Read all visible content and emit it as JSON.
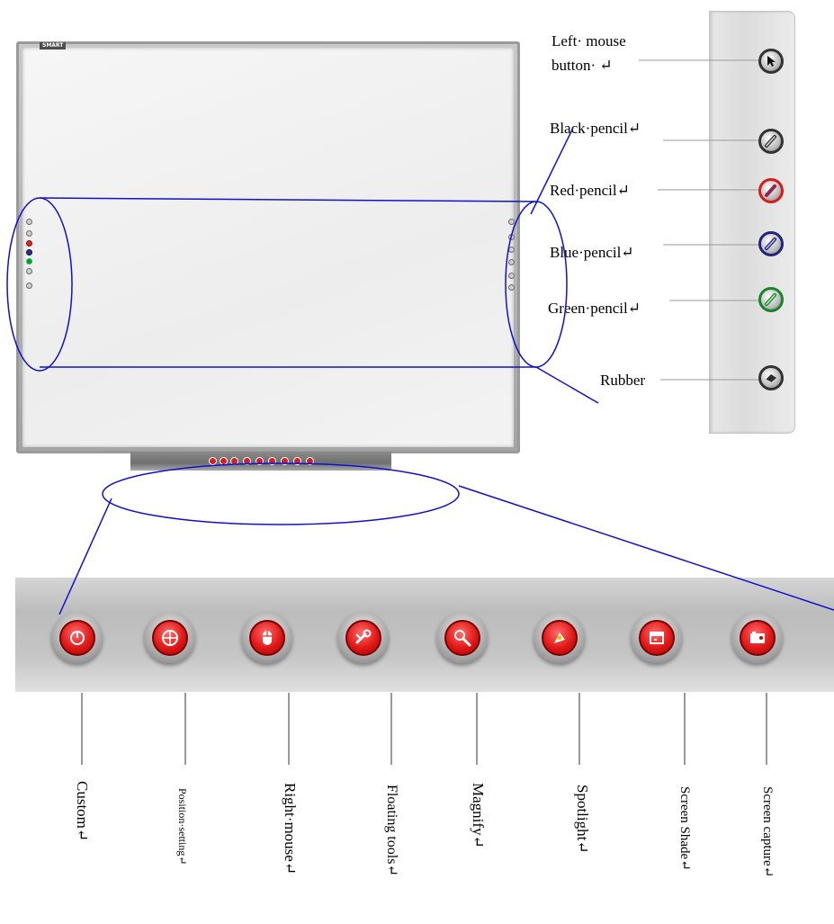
{
  "board": {
    "logo_text": "SMART"
  },
  "side_panel": {
    "items": [
      {
        "label_line1": "Left·     mouse",
        "label_line2": "button· ↵",
        "icon": "cursor-arrow-icon",
        "ring": "#2b2b2b"
      },
      {
        "label": "Black·pencil↵",
        "icon": "pencil-icon",
        "ring": "#2b2b2b"
      },
      {
        "label": "Red·pencil↵",
        "icon": "pencil-icon",
        "ring": "#d41c1c"
      },
      {
        "label": "Blue·pencil↵",
        "icon": "pencil-icon",
        "ring": "#23237a"
      },
      {
        "label": "Green·pencil↵",
        "icon": "pencil-icon",
        "ring": "#17852a"
      },
      {
        "label": "Rubber",
        "icon": "eraser-icon",
        "ring": "#2b2b2b"
      }
    ]
  },
  "toolbar": {
    "items": [
      {
        "label": "Custom↵",
        "icon": "custom-icon"
      },
      {
        "label": "Position·setting↵",
        "icon": "crosshair-icon"
      },
      {
        "label": "Right·mouse↵",
        "icon": "mouse-icon"
      },
      {
        "label": "Floating tools↵",
        "icon": "wrench-icon"
      },
      {
        "label": "Magnify↵",
        "icon": "magnifier-icon"
      },
      {
        "label": "Spotlight↵",
        "icon": "spotlight-icon"
      },
      {
        "label": "Screen Shade↵",
        "icon": "screen-shade-icon"
      },
      {
        "label": "Screen capture↵",
        "icon": "camera-icon"
      }
    ]
  },
  "colors": {
    "callout_line": "#1010d0",
    "tool_red": "#e01818",
    "side_panel": "#e3e3e3"
  }
}
